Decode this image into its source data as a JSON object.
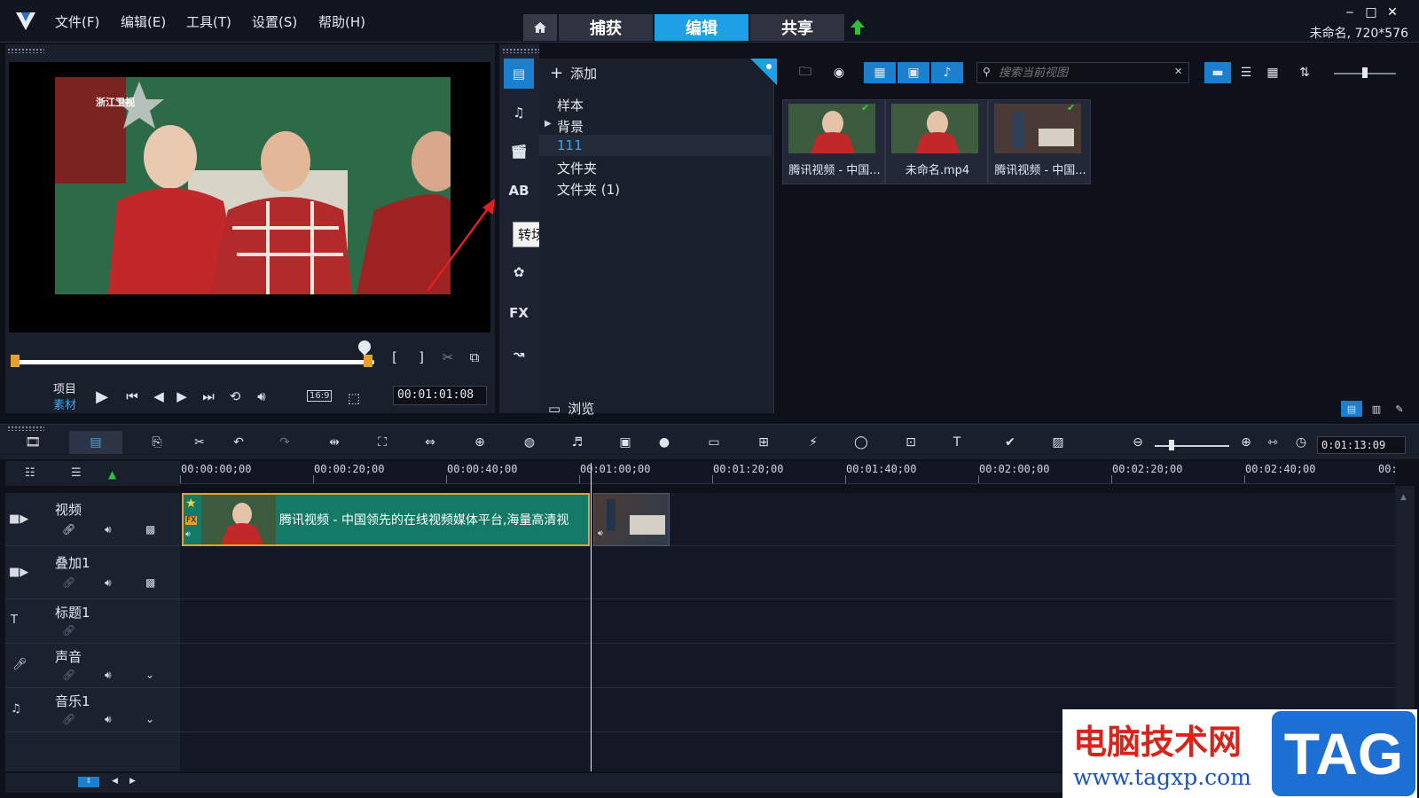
{
  "titlebar": {
    "menu": [
      "文件(F)",
      "编辑(E)",
      "工具(T)",
      "设置(S)",
      "帮助(H)"
    ],
    "tabs": [
      "捕获",
      "编辑",
      "共享"
    ],
    "active_tab": "编辑",
    "project_info": "未命名, 720*576"
  },
  "player": {
    "mode_project": "项目",
    "mode_clip": "素材",
    "aspect": "16:9",
    "timecode": "00:01:01:08",
    "channel_logo": "浙江卫视"
  },
  "library": {
    "add_label": "添加",
    "tooltip": "转场",
    "side_icon_fx": "FX",
    "folders": [
      "样本",
      "背景",
      "111",
      "文件夹",
      "文件夹 (1)"
    ],
    "selected_folder": "111",
    "browse_label": "浏览",
    "search_placeholder": "搜索当前视图",
    "thumbnails": [
      {
        "label": "腾讯视频 - 中国..."
      },
      {
        "label": "未命名.mp4"
      },
      {
        "label": "腾讯视频 - 中国..."
      }
    ]
  },
  "timeline": {
    "timecode": "0:01:13:09",
    "ruler": [
      "00:00:00;00",
      "00:00:20;00",
      "00:00:40;00",
      "00:01:00;00",
      "00:01:20;00",
      "00:01:40;00",
      "00:02:00;00",
      "00:02:20;00",
      "00:02:40;00",
      "00:"
    ],
    "tracks": [
      {
        "name": "视频"
      },
      {
        "name": "叠加1"
      },
      {
        "name": "标题1"
      },
      {
        "name": "声音"
      },
      {
        "name": "音乐1"
      }
    ],
    "clip_text": "腾讯视频 - 中国领先的在线视频媒体平台,海量高清视",
    "clip_badge": "FX"
  },
  "watermark": {
    "title": "电脑技术网",
    "url": "www.tagxp.com",
    "tag": "TAG"
  },
  "colors": {
    "accent": "#1ea0e6",
    "clip": "#137a66",
    "clip_border": "#e6a12a",
    "panel": "#1a1f2c"
  }
}
